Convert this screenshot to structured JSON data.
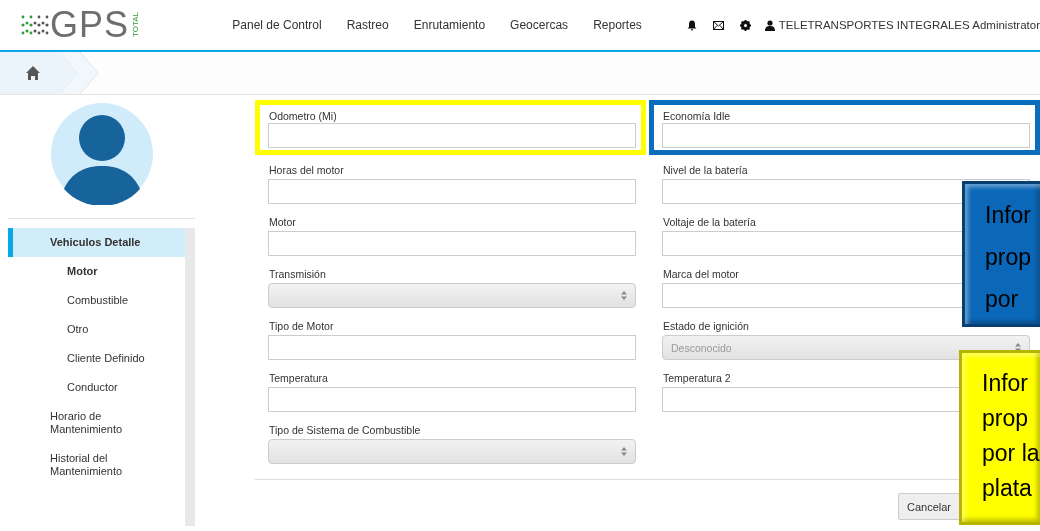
{
  "header": {
    "logo": {
      "text": "GPS",
      "sub": "TOTAL"
    },
    "nav": [
      "Panel de Control",
      "Rastreo",
      "Enrutamiento",
      "Geocercas",
      "Reportes"
    ],
    "user": "TELETRANSPORTES INTEGRALES Administrator"
  },
  "sidebar": {
    "items": [
      {
        "label": "Vehiculos Detalle",
        "selected": true,
        "children": [
          {
            "label": "Motor",
            "selected": true
          },
          {
            "label": "Combustible",
            "selected": false
          },
          {
            "label": "Otro",
            "selected": false
          },
          {
            "label": "Cliente Definido",
            "selected": false
          },
          {
            "label": "Conductor",
            "selected": false
          }
        ]
      },
      {
        "label": "Horario de Mantenimiento",
        "selected": false
      },
      {
        "label": "Historial del Mantenimiento",
        "selected": false
      }
    ]
  },
  "form": {
    "columns": [
      [
        {
          "label": "Odometro (Mi)",
          "kind": "text",
          "color": "#ffff00"
        },
        {
          "label": "Horas del motor",
          "kind": "text"
        },
        {
          "label": "Motor",
          "kind": "text"
        },
        {
          "label": "Transmisión",
          "kind": "select"
        },
        {
          "label": "Tipo de Motor",
          "kind": "text"
        },
        {
          "label": "Temperatura",
          "kind": "text"
        },
        {
          "label": "Tipo de Sistema de Combustible",
          "kind": "select"
        }
      ],
      [
        {
          "label": "Economía Idle",
          "kind": "text",
          "color": "#0a6ebd"
        },
        {
          "label": "Nivel de la batería",
          "kind": "text"
        },
        {
          "label": "Voltaje de la batería",
          "kind": "text"
        },
        {
          "label": "Marca del motor",
          "kind": "text"
        },
        {
          "label": "Estado de ignición",
          "kind": "select",
          "value": "Desconocido"
        },
        {
          "label": "Temperatura 2",
          "kind": "text"
        }
      ]
    ],
    "buttons": [
      "Cancelar"
    ]
  },
  "callouts": [
    {
      "color": "#0b68b8",
      "lines": [
        "Infor",
        "prop",
        "por"
      ]
    },
    {
      "color": "#ffff00",
      "lines": [
        "Infor",
        "prop",
        "por la",
        "plata"
      ]
    }
  ]
}
